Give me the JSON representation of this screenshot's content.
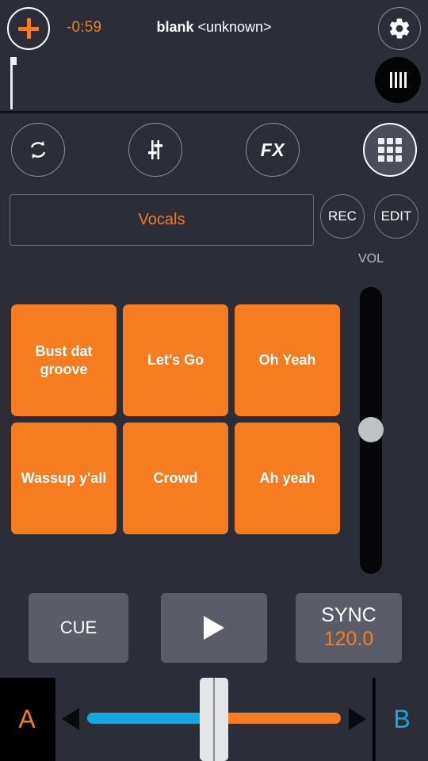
{
  "header": {
    "add_button_icon": "plus-icon",
    "time_remaining": "-0:59",
    "track_name": "blank",
    "track_artist": "<unknown>",
    "settings_icon": "gear-icon",
    "vinyl_icon": "beat-bars-icon"
  },
  "mode_row": {
    "loop_label": "loop-icon",
    "eq_label": "eq-sliders-icon",
    "fx_label": "FX",
    "pads_label": "pad-grid-icon",
    "active": "pads"
  },
  "bank": {
    "name": "Vocals",
    "rec_label": "REC",
    "edit_label": "EDIT"
  },
  "volume": {
    "label": "VOL",
    "value_percent": 50
  },
  "pads": [
    {
      "label": "Bust dat groove",
      "color": "#f57c1f"
    },
    {
      "label": "Let's Go",
      "color": "#f57c1f"
    },
    {
      "label": "Oh Yeah",
      "color": "#f57c1f"
    },
    {
      "label": "Wassup y'all",
      "color": "#f57c1f"
    },
    {
      "label": "Crowd",
      "color": "#f57c1f"
    },
    {
      "label": "Ah yeah",
      "color": "#f57c1f"
    }
  ],
  "transport": {
    "cue_label": "CUE",
    "play_icon": "play-icon",
    "sync_label": "SYNC",
    "bpm": "120.0"
  },
  "crossfader": {
    "deck_a_label": "A",
    "deck_b_label": "B",
    "position_percent": 50,
    "left_color": "#17a7e0",
    "right_color": "#f57c1f"
  },
  "colors": {
    "accent_orange": "#f57c1f",
    "accent_blue": "#17a7e0",
    "background": "#2b2e38",
    "button_gray": "#5a5d67"
  }
}
